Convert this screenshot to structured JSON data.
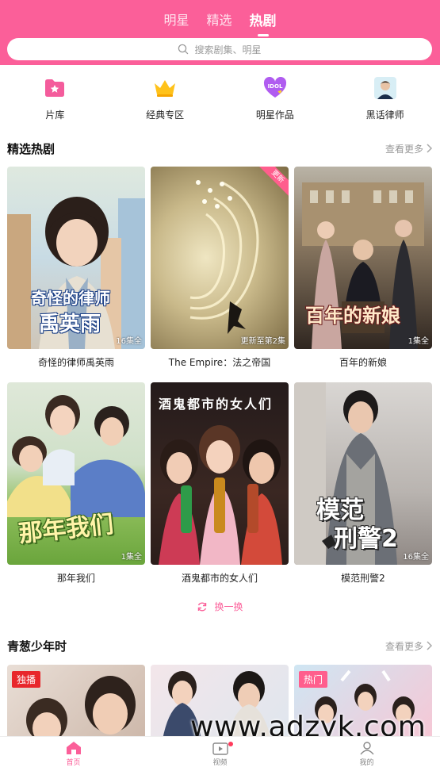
{
  "header": {
    "tabs": [
      {
        "label": "明星",
        "active": false
      },
      {
        "label": "精选",
        "active": false
      },
      {
        "label": "热剧",
        "active": true
      }
    ],
    "search_placeholder": "搜索剧集、明星",
    "bg_color": "#fb5f99"
  },
  "categories": [
    {
      "label": "片库",
      "icon": "folder-star-icon"
    },
    {
      "label": "经典专区",
      "icon": "crown-icon"
    },
    {
      "label": "明星作品",
      "icon": "idol-heart-icon"
    },
    {
      "label": "黑话律师",
      "icon": "actor-avatar-icon"
    }
  ],
  "featured": {
    "title": "精选热剧",
    "more": "查看更多",
    "refresh": "换一换",
    "items": [
      {
        "title": "奇怪的律师禹英雨",
        "badge": "16集全",
        "poster_text": [
          "奇怪的律师",
          "禹英雨"
        ]
      },
      {
        "title": "The Empire：法之帝国",
        "badge": "更新至第2集",
        "corner": "更新"
      },
      {
        "title": "百年的新娘",
        "badge": "1集全",
        "poster_text": [
          "百年的新娘"
        ]
      },
      {
        "title": "那年我们",
        "badge": "1集全",
        "poster_text": [
          "那年我们"
        ]
      },
      {
        "title": "酒鬼都市的女人们",
        "poster_text": [
          "酒鬼都市的女人们"
        ]
      },
      {
        "title": "模范刑警2",
        "badge": "16集全",
        "poster_text": [
          "模范",
          "刑警2"
        ]
      }
    ]
  },
  "youth": {
    "title": "青葱少年时",
    "more": "查看更多",
    "items": [
      {
        "tag": "独播"
      },
      {
        "tag": ""
      },
      {
        "tag": "热门"
      }
    ]
  },
  "watermark": "www.adzyk.com",
  "nav": [
    {
      "label": "首页",
      "active": true
    },
    {
      "label": "视频",
      "active": false
    },
    {
      "label": "我的",
      "active": false
    }
  ]
}
